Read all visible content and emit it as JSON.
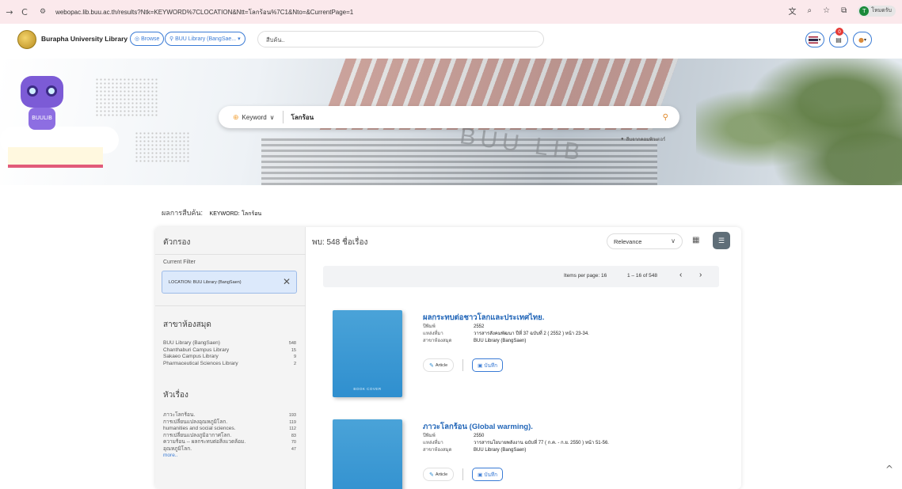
{
  "browser": {
    "url": "webopac.lib.buu.ac.th/results?Ntk=KEYWORD%7CLOCATION&Ntt=โลกร้อน%7C1&Nto=&CurrentPage=1",
    "profile_initial": "T",
    "profile_label": "โหมดรับ",
    "nav_forward": "→",
    "nav_reload": "C"
  },
  "header": {
    "site_title": "Burapha University Library",
    "browse_label": "Browse",
    "location_label": "BUU Library (BangSae...",
    "search_placeholder": "สืบค้น..",
    "notification_count": "0"
  },
  "hero": {
    "robot_label": "BUULIB",
    "building_text": "BUU LIB",
    "search_type": "Keyword",
    "search_value": "โลกร้อน",
    "advanced_label": "สืบจากคอมพิวเตอร์",
    "book_cover_text": "BOOK COVER"
  },
  "results": {
    "label": "ผลการสืบค้น:",
    "keyword_key": "KEYWORD:",
    "keyword_value": "โลกร้อน",
    "found": "พบ: 548 ชื่อเรื่อง",
    "sort": "Relevance",
    "items_per_page": "Items per page: 16",
    "range": "1 – 16 of 548"
  },
  "sidebar": {
    "title": "ตัวกรอง",
    "current_filter_label": "Current Filter",
    "current_filter_value": "LOCATION: BUU Library (BangSaen)",
    "libraries_title": "สาขาห้องสมุด",
    "libraries": [
      {
        "name": "BUU Library (BangSaen)",
        "count": "548"
      },
      {
        "name": "Chanthaburi Campus Library",
        "count": "15"
      },
      {
        "name": "Sakaeo Campus Library",
        "count": "9"
      },
      {
        "name": "Pharmaceutical Sciences Library",
        "count": "2"
      }
    ],
    "subjects_title": "หัวเรื่อง",
    "subjects": [
      {
        "name": "ภาวะโลกร้อน.",
        "count": "193"
      },
      {
        "name": "การเปลี่ยนแปลงอุณหภูมิโลก.",
        "count": "119"
      },
      {
        "name": "humanities and social sciences.",
        "count": "112"
      },
      {
        "name": "การเปลี่ยนแปลงภูมิอากาศโลก.",
        "count": "83"
      },
      {
        "name": "ความร้อน -- ผลกระทบต่อสิ่งแวดล้อม.",
        "count": "70"
      },
      {
        "name": "อุณหภูมิโลก.",
        "count": "47"
      }
    ],
    "more_label": "more.."
  },
  "records": [
    {
      "title": "ผลกระทบต่อชาวโลกและประเทศไทย.",
      "year_label": "ปีพิมพ์",
      "year": "2552",
      "source_label": "แหล่งที่มา",
      "source": "วารสารสังคมพัฒนา ปีที่ 37 ฉบับที่ 2 ( 2552 ) หน้า 23-34.",
      "library_label": "สาขาห้องสมุด",
      "library": "BUU Library (BangSaen)",
      "type": "Article",
      "save_label": "บันทึก"
    },
    {
      "title": "ภาวะโลกร้อน (Global warming).",
      "year_label": "ปีพิมพ์",
      "year": "2550",
      "source_label": "แหล่งที่มา",
      "source": "วารสารนโยบายพลังงาน ฉบับที่ 77 ( ก.ค. - ก.ย. 2550 ) หน้า 51-56.",
      "library_label": "สาขาห้องสมุด",
      "library": "BUU Library (BangSaen)",
      "type": "Article",
      "save_label": "บันทึก"
    }
  ]
}
